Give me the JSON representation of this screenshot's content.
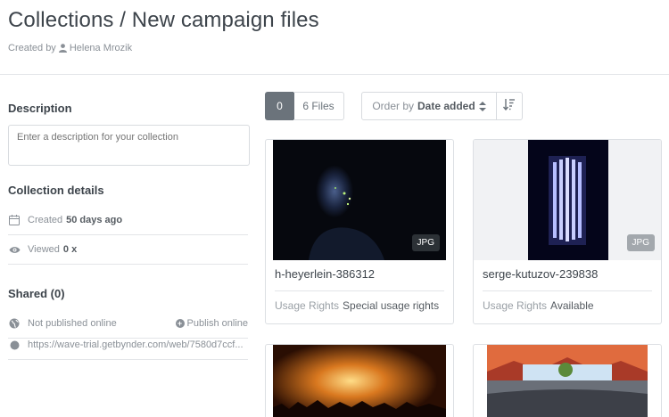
{
  "header": {
    "title": "Collections / New campaign files",
    "created_by_prefix": "Created by",
    "created_by_name": "Helena Mrozik"
  },
  "sidebar": {
    "description_title": "Description",
    "description_placeholder": "Enter a description for your collection",
    "details_title": "Collection details",
    "created_label": "Created",
    "created_value": "50 days ago",
    "viewed_label": "Viewed",
    "viewed_value": "0 x",
    "shared_title": "Shared (0)",
    "publish_status": "Not published online",
    "publish_action": "Publish online",
    "share_link": "https://wave-trial.getbynder.com/web/7580d7ccf..."
  },
  "toolbar": {
    "selected_count": "0",
    "files_label": "6 Files",
    "order_prefix": "Order by",
    "order_value": "Date added"
  },
  "assets": [
    {
      "name": "h-heyerlein-386312",
      "type": "JPG",
      "rights_label": "Usage Rights",
      "rights_value": "Special usage rights"
    },
    {
      "name": "serge-kutuzov-239838",
      "type": "JPG",
      "rights_label": "Usage Rights",
      "rights_value": "Available"
    },
    {
      "name": "",
      "type": "",
      "rights_label": "",
      "rights_value": ""
    },
    {
      "name": "",
      "type": "",
      "rights_label": "",
      "rights_value": ""
    }
  ],
  "colors": {
    "primary_text": "#3d444b",
    "muted_text": "#8a9097",
    "border": "#dcdfe3",
    "active_button": "#6b737b"
  },
  "icons": [
    "user-icon",
    "calendar-icon",
    "eye-icon",
    "globe-icon",
    "circle-plus-icon",
    "link-dot-icon",
    "sort-updown-icon",
    "sort-descending-icon"
  ]
}
